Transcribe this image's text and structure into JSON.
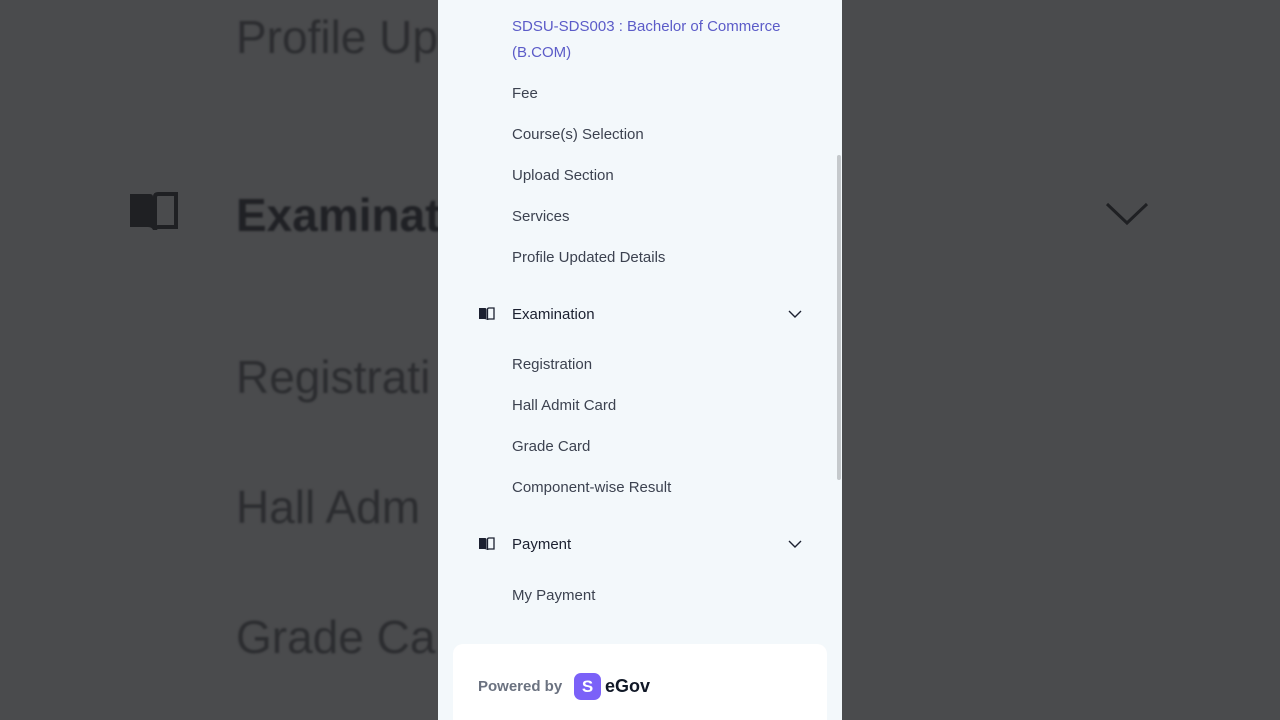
{
  "background": {
    "texts": [
      "Profile Up",
      "Examinat",
      "Registrati",
      "Hall Adm",
      "Grade Ca"
    ]
  },
  "menu": {
    "course_item": "SDSU-SDS003 : Bachelor of Commerce (B.COM)",
    "profile_items": [
      "Fee",
      "Course(s) Selection",
      "Upload Section",
      "Services",
      "Profile Updated Details"
    ],
    "examination": {
      "label": "Examination",
      "items": [
        "Registration",
        "Hall Admit Card",
        "Grade Card",
        "Component-wise Result"
      ]
    },
    "payment": {
      "label": "Payment",
      "items": [
        "My Payment"
      ]
    }
  },
  "footer": {
    "powered_by": "Powered by",
    "logo_letter": "S",
    "brand": "eGov"
  },
  "colors": {
    "accent": "#5b5bc8",
    "logo": "#7b61f8",
    "panel_bg": "#f3f8fb"
  }
}
